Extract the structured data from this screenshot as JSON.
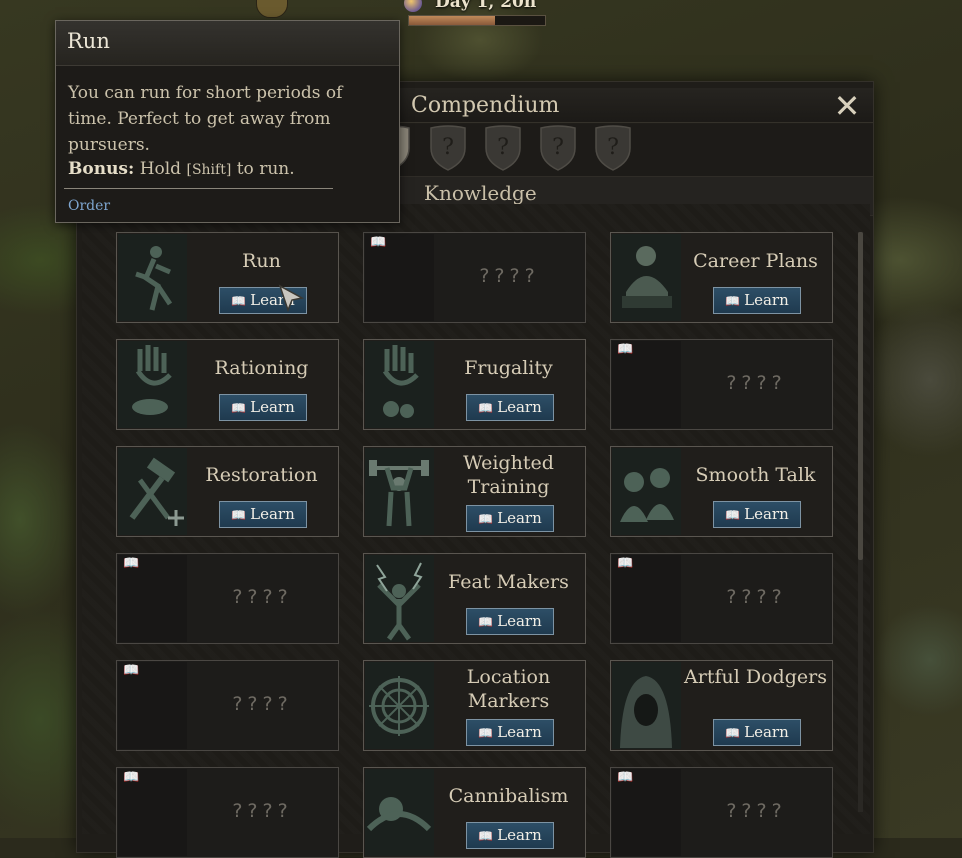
{
  "hud": {
    "day_label": "Day 1, 20h",
    "day_progress": 0.63
  },
  "panel": {
    "title": "Compendium",
    "subtitle": "Knowledge",
    "close_icon": "close-icon",
    "tabs": [
      {
        "label": "",
        "icon": "shield-tab-icon",
        "state": "dim"
      },
      {
        "label": "",
        "icon": "shield-tab-icon",
        "state": "active"
      },
      {
        "label": "?",
        "icon": "locked-shield-icon",
        "state": "locked"
      },
      {
        "label": "?",
        "icon": "locked-shield-icon",
        "state": "locked"
      },
      {
        "label": "?",
        "icon": "locked-shield-icon",
        "state": "locked"
      },
      {
        "label": "?",
        "icon": "locked-shield-icon",
        "state": "locked"
      }
    ]
  },
  "cards": [
    {
      "name": "Run",
      "state": "learn",
      "learn_label": "Learn",
      "icon": "run-figure-icon"
    },
    {
      "name": "????",
      "state": "locked",
      "icon": "book-icon"
    },
    {
      "name": "Career Plans",
      "state": "learn",
      "learn_label": "Learn",
      "icon": "career-figure-icon"
    },
    {
      "name": "Rationing",
      "state": "learn",
      "learn_label": "Learn",
      "icon": "hand-fish-icon"
    },
    {
      "name": "Frugality",
      "state": "learn",
      "learn_label": "Learn",
      "icon": "hand-coins-icon"
    },
    {
      "name": "????",
      "state": "locked",
      "icon": "book-icon"
    },
    {
      "name": "Restoration",
      "state": "learn",
      "learn_label": "Learn",
      "icon": "hammer-plus-icon"
    },
    {
      "name": "Weighted Training",
      "state": "learn",
      "learn_label": "Learn",
      "icon": "weightlift-icon"
    },
    {
      "name": "Smooth Talk",
      "state": "learn",
      "learn_label": "Learn",
      "icon": "talk-figures-icon"
    },
    {
      "name": "????",
      "state": "locked",
      "icon": "book-icon"
    },
    {
      "name": "Feat Makers",
      "state": "learn",
      "learn_label": "Learn",
      "icon": "lightning-figure-icon"
    },
    {
      "name": "????",
      "state": "locked",
      "icon": "book-icon"
    },
    {
      "name": "????",
      "state": "locked",
      "icon": "book-icon"
    },
    {
      "name": "Location Markers",
      "state": "learn",
      "learn_label": "Learn",
      "icon": "compass-icon"
    },
    {
      "name": "Artful Dodgers",
      "state": "learn",
      "learn_label": "Learn",
      "icon": "hooded-figure-icon"
    },
    {
      "name": "????",
      "state": "locked",
      "icon": "book-icon"
    },
    {
      "name": "Cannibalism",
      "state": "learn",
      "learn_label": "Learn",
      "icon": "cannibal-icon"
    },
    {
      "name": "????",
      "state": "locked",
      "icon": "book-icon"
    }
  ],
  "tooltip": {
    "title": "Run",
    "body": "You can run for short periods of time. Perfect to get away from pursuers.",
    "bonus_label": "Bonus:",
    "bonus_pre": "Hold",
    "bonus_key": "[Shift]",
    "bonus_post": "to run.",
    "tag": "Order"
  },
  "colors": {
    "learn_button": "#2d4e66",
    "card_border": "#5a5650",
    "tooltip_tag": "#7ea6d0"
  }
}
